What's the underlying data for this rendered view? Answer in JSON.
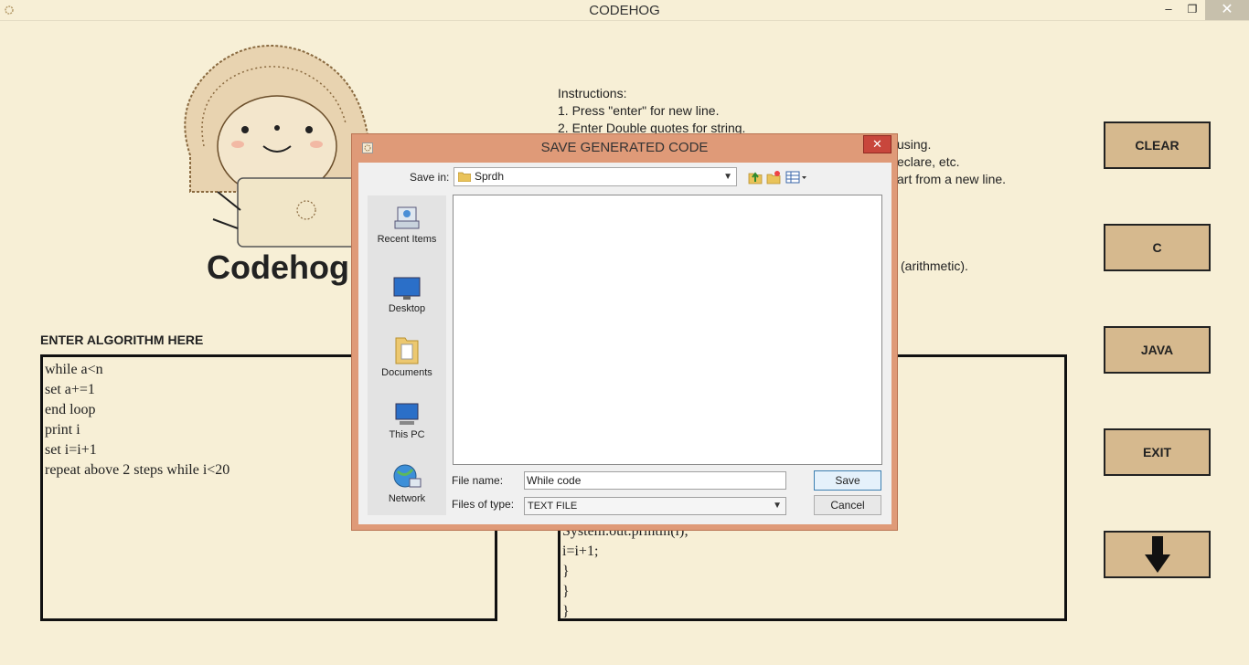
{
  "window": {
    "title": "CODEHOG",
    "minimize": "–",
    "maximize": "❐",
    "close": "✕"
  },
  "logo": {
    "word": "Codehog"
  },
  "instructions": {
    "heading": "Instructions:",
    "lines": [
      "1. Press \"enter\" for new line.",
      "2. Enter Double quotes for string."
    ],
    "partial": [
      "using.",
      "eclare, etc.",
      "art from a new line.",
      "(arithmetic)."
    ]
  },
  "buttons": {
    "clear": "CLEAR",
    "c": "C",
    "java": "JAVA",
    "exit": "EXIT"
  },
  "algorithm": {
    "label": "ENTER ALGORITHM HERE",
    "lines": [
      "while a<n",
      "set a+=1",
      "end loop",
      "print i",
      "set i=i+1",
      "repeat above 2 steps while i<20"
    ]
  },
  "code_output": {
    "lines": [
      "System.out.println(i);",
      "i=i+1;",
      "}",
      "}",
      "}"
    ]
  },
  "dialog": {
    "title": "SAVE GENERATED CODE",
    "close": "✕",
    "save_in_label": "Save in:",
    "save_in_value": "Sprdh",
    "places": [
      "Recent Items",
      "Desktop",
      "Documents",
      "This PC",
      "Network"
    ],
    "file_name_label": "File name:",
    "file_name_value": "While code",
    "file_type_label": "Files of type:",
    "file_type_value": "TEXT FILE",
    "save_button": "Save",
    "cancel_button": "Cancel"
  }
}
